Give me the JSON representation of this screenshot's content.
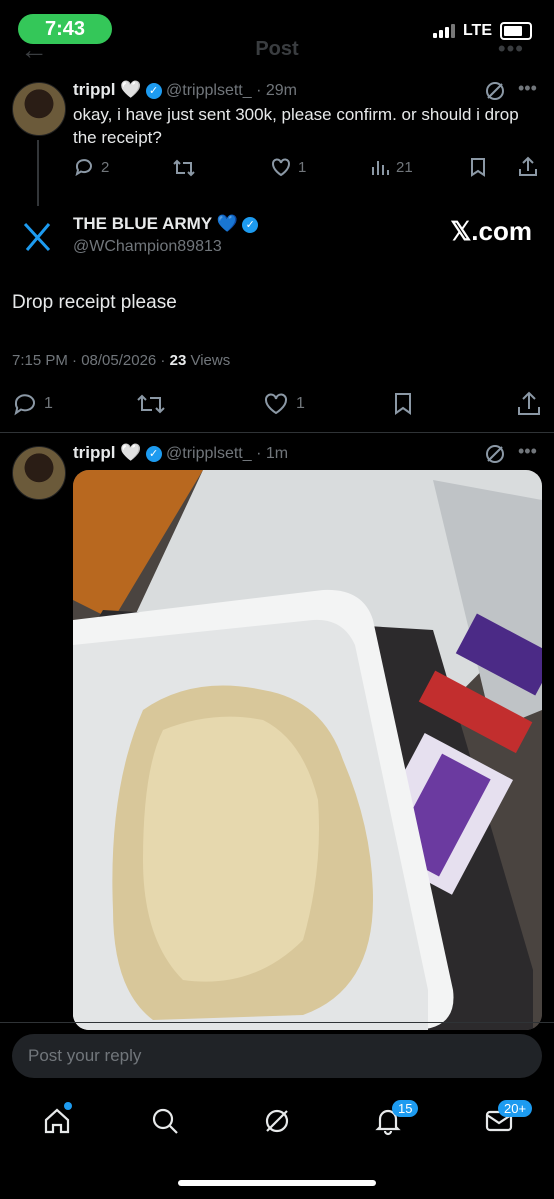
{
  "status_bar": {
    "time": "7:43",
    "network": "LTE"
  },
  "header": {
    "title": "Post"
  },
  "quoted_tweet": {
    "name": "trippl",
    "badge_emoji": "🤍",
    "handle": "@tripplsett_",
    "age": "29m",
    "text": "okay, i have just sent 300k, please confirm. or should i drop the receipt?",
    "replies": "2",
    "likes": "1",
    "views": "21"
  },
  "main_tweet": {
    "name": "THE BLUE ARMY",
    "badge_emoji": "💙",
    "handle": "@WChampion89813",
    "site_label": "𝕏.com",
    "text": "Drop receipt please",
    "meta_time": "7:15 PM · 08/05/2026 · ",
    "views_count": "23",
    "views_label": " Views",
    "replies": "1",
    "likes": "1"
  },
  "reply_tweet": {
    "name": "trippl",
    "badge_emoji": "🤍",
    "handle": "@tripplsett_",
    "age": "1m"
  },
  "reply_input": {
    "placeholder": "Post your reply"
  },
  "bottom_nav": {
    "notifications_count": "15",
    "messages_count": "20+"
  },
  "colors": {
    "accent": "#1d9bf0",
    "background": "#000000",
    "muted": "#71767b",
    "status_green": "#34c759"
  },
  "icons": [
    "back-arrow-icon",
    "grok-icon",
    "more-icon",
    "reply-icon",
    "retweet-icon",
    "like-icon",
    "views-icon",
    "bookmark-icon",
    "share-icon",
    "x-logo-icon",
    "home-icon",
    "search-icon",
    "notifications-icon",
    "messages-icon"
  ]
}
